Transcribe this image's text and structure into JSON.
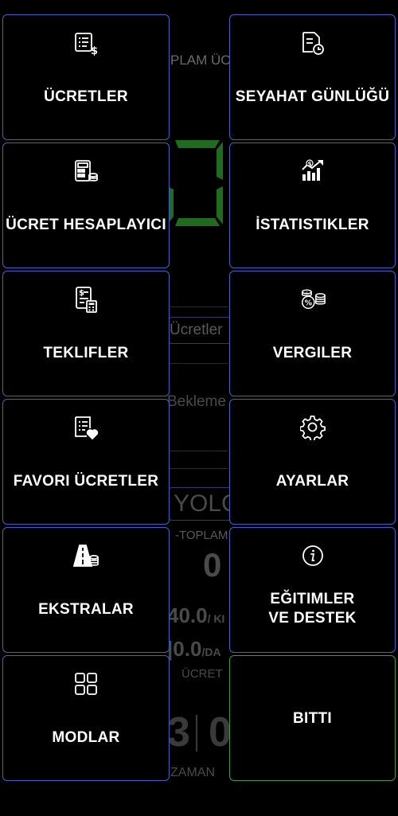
{
  "background": {
    "total_fare_label": "PLAM ÜC",
    "fares_button": "Ücretler",
    "waiting": "Bekleme",
    "road": "YOLC",
    "total": "-TOPLAM",
    "total_value": "0",
    "rate_km": "40.0",
    "rate_km_unit": "/ KI",
    "rate_min": "0.0",
    "rate_min_unit": "/DA",
    "fare": "ÜCRET",
    "time_digits": "3",
    "time_digits2": "0",
    "time": "ZAMAN",
    "digit_color": "#1f6b1f"
  },
  "menu": {
    "fares": {
      "label": "ÜCRETLER",
      "icon": "receipt-dollar-icon"
    },
    "travel_log": {
      "label": "SEYAHAT GÜNLÜĞÜ",
      "icon": "document-clock-icon"
    },
    "fare_calculator": {
      "label": "ÜCRET HESAPLAYICI",
      "icon": "calculator-coins-icon"
    },
    "statistics": {
      "label": "İSTATISTIKLER",
      "icon": "chart-growth-icon"
    },
    "quotes": {
      "label": "TEKLIFLER",
      "icon": "invoice-calculator-icon"
    },
    "taxes": {
      "label": "VERGILER",
      "icon": "coins-percent-icon"
    },
    "favorite_fares": {
      "label": "FAVORI ÜCRETLER",
      "icon": "document-heart-icon"
    },
    "settings": {
      "label": "AYARLAR",
      "icon": "gear-icon"
    },
    "extras": {
      "label": "EKSTRALAR",
      "icon": "road-coins-icon"
    },
    "training_line1": "EĞITIMLER",
    "training_line2": "VE DESTEK",
    "training_icon": "info-icon",
    "modes": {
      "label": "MODLAR",
      "icon": "grid-icon"
    },
    "done": {
      "label": "BITTI"
    }
  },
  "colors": {
    "tile_border": "#3b64c8",
    "done_border": "#3f9a3a",
    "background": "#000000"
  }
}
